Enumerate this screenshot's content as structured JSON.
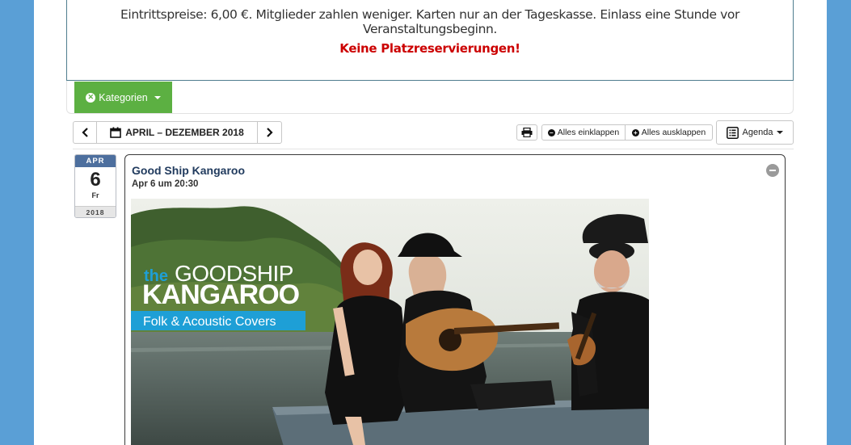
{
  "notice": {
    "prices": "Eintrittspreise: 6,00 €. Mitglieder zahlen weniger. Karten nur an der Tageskasse. Einlass eine Stunde vor Veranstaltungsbeginn.",
    "warning": "Keine Platzreservierungen!"
  },
  "filter": {
    "categories_label": "Kategorien"
  },
  "toolbar": {
    "range_label": "APRIL – DEZEMBER 2018",
    "collapse_all": "Alles einklappen",
    "expand_all": "Alles ausklappen",
    "view_label": "Agenda"
  },
  "event": {
    "month": "APR",
    "day": "6",
    "weekday": "Fr",
    "year": "2018",
    "title": "Good Ship Kangaroo",
    "time": "Apr 6 um 20:30",
    "poster": {
      "logo_the": "the",
      "logo_goodship": "GOODSHIP",
      "logo_kangaroo": "KANGAROO",
      "banner": "Folk & Acoustic Covers"
    }
  },
  "colors": {
    "background": "#5a9fd6",
    "accent_green": "#5cb042",
    "warning_red": "#cc0000",
    "date_header": "#4d6f9e",
    "poster_blue": "#1e9fd6"
  },
  "icons": [
    "times-circle-icon",
    "chevron-left-icon",
    "calendar-icon",
    "chevron-right-icon",
    "print-icon",
    "minus-circle-icon",
    "plus-circle-icon",
    "agenda-list-icon",
    "collapse-event-icon"
  ]
}
